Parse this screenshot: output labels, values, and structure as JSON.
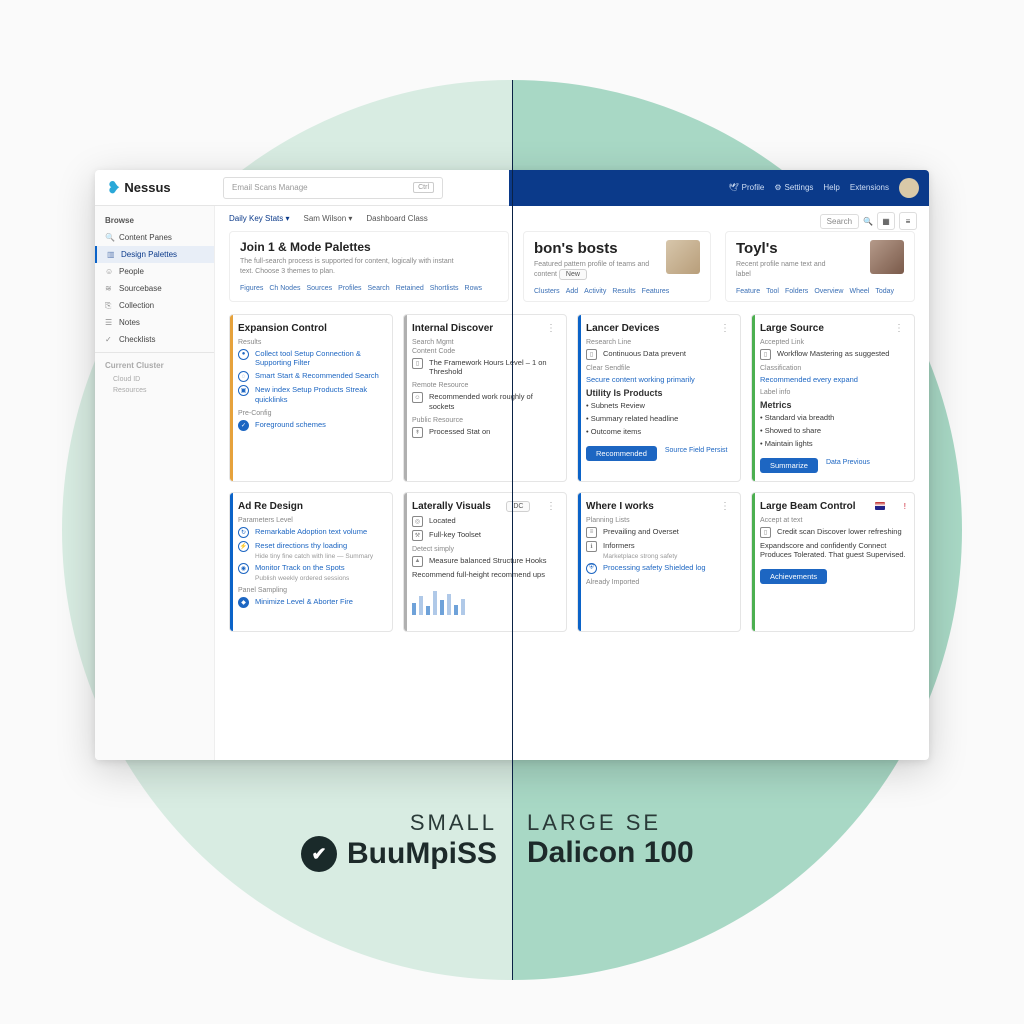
{
  "app": {
    "name": "Nessus"
  },
  "search": {
    "placeholder": "Email Scans Manage",
    "chip": "Ctrl"
  },
  "topnav": {
    "items": [
      {
        "icon": "bird-icon",
        "label": "Profile"
      },
      {
        "icon": "gear-icon",
        "label": "Settings"
      },
      {
        "icon": "sun-icon",
        "label": "Help"
      },
      {
        "icon": "grid-icon",
        "label": "Extensions"
      }
    ]
  },
  "sidebar": {
    "heading": "Browse",
    "items": [
      {
        "icon": "search-icon",
        "label": "Content Panes"
      },
      {
        "icon": "layers-icon",
        "label": "Design Palettes",
        "active": true
      },
      {
        "icon": "person-icon",
        "label": "People"
      },
      {
        "icon": "database-icon",
        "label": "Sourcebase"
      },
      {
        "icon": "bookmark-icon",
        "label": "Collection"
      },
      {
        "icon": "archive-icon",
        "label": "Notes"
      },
      {
        "icon": "clipboard-icon",
        "label": "Checklists"
      }
    ],
    "section2": "Current Cluster",
    "sub1": "Cloud ID",
    "sub2": "Resources"
  },
  "tabs": {
    "items": [
      "Daily Key Stats ▾",
      "Sam Wilson ▾",
      "Dashboard Class"
    ]
  },
  "rightsearch": {
    "placeholder": "Search"
  },
  "profiles": [
    {
      "title": "Join 1 & Mode Palettes",
      "sub": "The full-search process is supported for content, logically with instant text. Choose 3 themes to plan."
    },
    {
      "title": "bon's bosts",
      "sub": "Featured pattern profile of teams and content",
      "badge": "New"
    },
    {
      "title": "Toyl's",
      "sub": "Recent profile name text and label"
    }
  ],
  "chips": {
    "a": [
      "Figures",
      "Ch Nodes",
      "Sources",
      "Profiles",
      "Search",
      "Retained",
      "Shortlists",
      "Rows"
    ],
    "b": [
      "Clusters",
      "Add",
      "Activity",
      "Results",
      "Features"
    ],
    "c": [
      "Feature",
      "Tool",
      "Folders",
      "Overview",
      "Wheel",
      "Today"
    ]
  },
  "cards": [
    {
      "accent": "orange",
      "title": "Expansion Control",
      "label1": "Results",
      "r1": "Collect tool Setup Connection & Supporting Filter",
      "label2": "",
      "r2": "Smart Start & Recommended Search",
      "r3": "New index Setup Products Streak quicklinks",
      "label3": "Pre-Config",
      "r4": "Foreground schemes"
    },
    {
      "accent": "gray",
      "title": "Internal Discover",
      "label1": "Search Mgmt",
      "sec1": "Content Code",
      "r1": "The Framework Hours Level – 1 on Threshold",
      "label2": "Remote Resource",
      "r2": "Recommended work roughly of sockets",
      "label3": "Public Resource",
      "r3": "Processed Stat on"
    },
    {
      "accent": "blue",
      "title": "Lancer Devices",
      "label1": "Research Line",
      "r1": "Continuous Data prevent",
      "label2": "Clear Sendfile",
      "r2": "Secure content working primarily",
      "heading": "Utility Is Products",
      "r3": "• Subnets Review",
      "r4": "• Summary related headline",
      "r5": "• Outcome items",
      "btn1": "Recommended",
      "link1": "Source Field Persist"
    },
    {
      "accent": "green",
      "title": "Large Source",
      "label1": "Accepted Link",
      "r1": "Workflow Mastering as suggested",
      "label2": "Classification",
      "r2": "Recommended every expand",
      "label3": "Label info",
      "heading": "Metrics",
      "r3": "• Standard via breadth",
      "r4": "• Showed to share",
      "r5": "• Maintain lights",
      "btn1": "Summarize",
      "link1": "Data Previous"
    },
    {
      "accent": "blue",
      "title": "Ad Re Design",
      "label1": "Parameters Level",
      "r1": "Remarkable Adoption text volume",
      "r2": "Reset directions thy loading",
      "sub2": "Hide tiny fine catch with line — Summary",
      "r3": "Monitor Track on the Spots",
      "sub3": "Publish weekly ordered sessions",
      "label2": "Panel Sampling",
      "r4": "Minimize Level & Aborter Fire"
    },
    {
      "accent": "gray",
      "title": "Laterally Visuals",
      "pill": "DC",
      "r1": "Located",
      "r2": "Full-key Toolset",
      "label1": "Detect simply",
      "r3": "Measure balanced Structure Hooks",
      "r4": "Recommend full-height recommend ups"
    },
    {
      "accent": "blue",
      "title": "Where I works",
      "label1": "Planning Lists",
      "r1": "Prevailing and Overset",
      "r2": "Informers",
      "sub2": "Marketplace strong safety",
      "r3": "Processing safety Shielded log",
      "label2": "Already Imported"
    },
    {
      "accent": "green",
      "title": "Large Beam Control",
      "label1": "Accept at text",
      "r1": "Credit scan Discover lower refreshing",
      "r2": "Expandscore and confidently Connect Produces Tolerated. That guest Supervised.",
      "btn1": "Achievements"
    }
  ],
  "caption": {
    "left_small": "SMALL",
    "left_big": "BuuMpiSS",
    "right_small": "LARGE SE",
    "right_big": "Dalicon 100"
  }
}
